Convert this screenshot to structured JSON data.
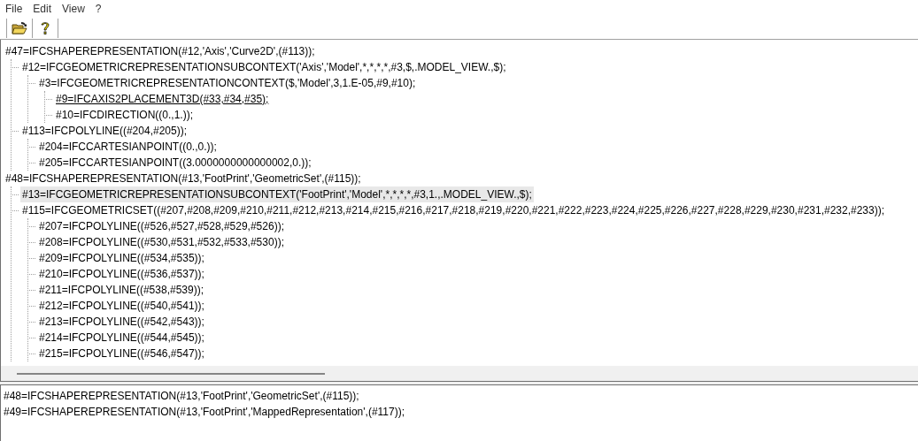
{
  "menu": [
    "File",
    "Edit",
    "View",
    "?"
  ],
  "toolbar": [
    {
      "kind": "open"
    },
    {
      "kind": "help"
    }
  ],
  "tree": [
    {
      "label": "#47=IFCSHAPEREPRESENTATION(#12,'Axis','Curve2D',(#113));",
      "selected": false,
      "hot": false,
      "children": [
        {
          "label": "#12=IFCGEOMETRICREPRESENTATIONSUBCONTEXT('Axis','Model',*,*,*,*,#3,$,.MODEL_VIEW.,$);",
          "selected": false,
          "hot": false,
          "children": [
            {
              "label": "#3=IFCGEOMETRICREPRESENTATIONCONTEXT($,'Model',3,1.E-05,#9,#10);",
              "selected": false,
              "hot": false,
              "children": [
                {
                  "label": "#9=IFCAXIS2PLACEMENT3D(#33,#34,#35);",
                  "selected": false,
                  "hot": true
                },
                {
                  "label": "#10=IFCDIRECTION((0.,1.));",
                  "selected": false,
                  "hot": false
                }
              ]
            }
          ]
        },
        {
          "label": "#113=IFCPOLYLINE((#204,#205));",
          "selected": false,
          "hot": false,
          "children": [
            {
              "label": "#204=IFCCARTESIANPOINT((0.,0.));",
              "selected": false,
              "hot": false
            },
            {
              "label": "#205=IFCCARTESIANPOINT((3.0000000000000002,0.));",
              "selected": false,
              "hot": false
            }
          ]
        }
      ]
    },
    {
      "label": "#48=IFCSHAPEREPRESENTATION(#13,'FootPrint','GeometricSet',(#115));",
      "selected": false,
      "hot": false,
      "children": [
        {
          "label": "#13=IFCGEOMETRICREPRESENTATIONSUBCONTEXT('FootPrint','Model',*,*,*,*,#3,1.,.MODEL_VIEW.,$);",
          "selected": true,
          "hot": false
        },
        {
          "label": "#115=IFCGEOMETRICSET((#207,#208,#209,#210,#211,#212,#213,#214,#215,#216,#217,#218,#219,#220,#221,#222,#223,#224,#225,#226,#227,#228,#229,#230,#231,#232,#233));",
          "selected": false,
          "hot": false,
          "children": [
            {
              "label": "#207=IFCPOLYLINE((#526,#527,#528,#529,#526));",
              "selected": false,
              "hot": false
            },
            {
              "label": "#208=IFCPOLYLINE((#530,#531,#532,#533,#530));",
              "selected": false,
              "hot": false
            },
            {
              "label": "#209=IFCPOLYLINE((#534,#535));",
              "selected": false,
              "hot": false
            },
            {
              "label": "#210=IFCPOLYLINE((#536,#537));",
              "selected": false,
              "hot": false
            },
            {
              "label": "#211=IFCPOLYLINE((#538,#539));",
              "selected": false,
              "hot": false
            },
            {
              "label": "#212=IFCPOLYLINE((#540,#541));",
              "selected": false,
              "hot": false
            },
            {
              "label": "#213=IFCPOLYLINE((#542,#543));",
              "selected": false,
              "hot": false
            },
            {
              "label": "#214=IFCPOLYLINE((#544,#545));",
              "selected": false,
              "hot": false
            },
            {
              "label": "#215=IFCPOLYLINE((#546,#547));",
              "selected": false,
              "hot": false
            }
          ]
        }
      ]
    }
  ],
  "references": [
    "#48=IFCSHAPEREPRESENTATION(#13,'FootPrint','GeometricSet',(#115));",
    "#49=IFCSHAPEREPRESENTATION(#13,'FootPrint','MappedRepresentation',(#117));"
  ]
}
